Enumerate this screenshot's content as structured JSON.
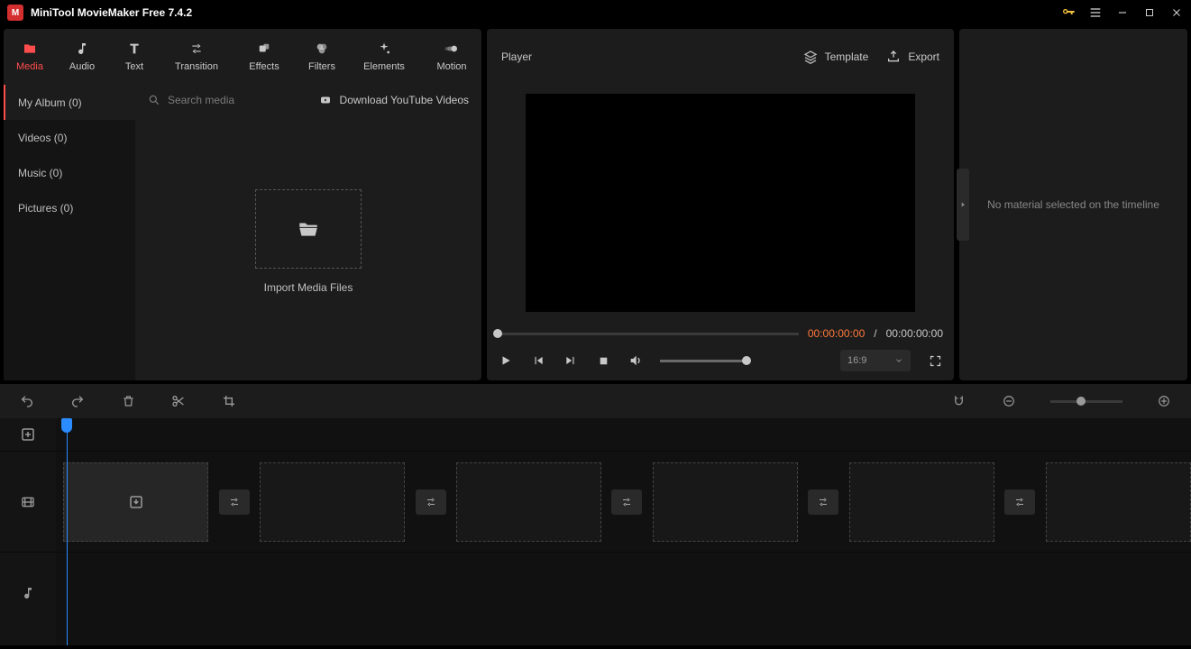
{
  "titlebar": {
    "title": "MiniTool MovieMaker Free 7.4.2"
  },
  "tabs": {
    "media": "Media",
    "audio": "Audio",
    "text": "Text",
    "transition": "Transition",
    "effects": "Effects",
    "filters": "Filters",
    "elements": "Elements",
    "motion": "Motion"
  },
  "sidebar": {
    "items": [
      "My Album (0)",
      "Videos (0)",
      "Music (0)",
      "Pictures (0)"
    ]
  },
  "media": {
    "search_placeholder": "Search media",
    "download_label": "Download YouTube Videos",
    "import_label": "Import Media Files"
  },
  "player": {
    "title": "Player",
    "template_label": "Template",
    "export_label": "Export",
    "time_current": "00:00:00:00",
    "time_separator": "/",
    "time_total": "00:00:00:00",
    "aspect": "16:9"
  },
  "right": {
    "message": "No material selected on the timeline"
  }
}
